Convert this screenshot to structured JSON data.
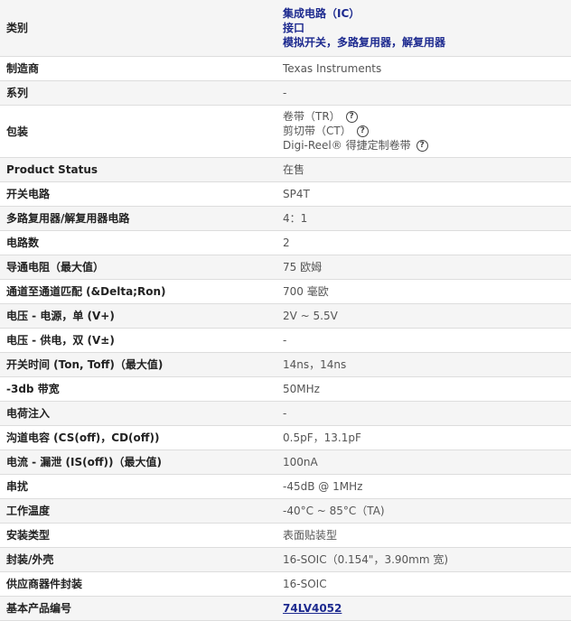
{
  "rows": {
    "category": {
      "label": "类别",
      "values": [
        "集成电路（IC）",
        "接口",
        "模拟开关，多路复用器，解复用器"
      ]
    },
    "manufacturer": {
      "label": "制造商",
      "value": "Texas Instruments"
    },
    "series": {
      "label": "系列",
      "value": "-"
    },
    "packaging": {
      "label": "包装",
      "values": [
        "卷带（TR）",
        "剪切带（CT）",
        "Digi-Reel® 得捷定制卷带"
      ]
    },
    "product_status": {
      "label": "Product Status",
      "value": "在售"
    },
    "switch_circuit": {
      "label": "开关电路",
      "value": "SP4T"
    },
    "mux_circuit": {
      "label": "多路复用器/解复用器电路",
      "value": "4：1"
    },
    "circuit_count": {
      "label": "电路数",
      "value": "2"
    },
    "on_resistance": {
      "label": "导通电阻（最大值）",
      "value": "75 欧姆"
    },
    "channel_match": {
      "label": "通道至通道匹配 (&Delta;Ron)",
      "value": "700 毫欧"
    },
    "voltage_single": {
      "label": "电压 - 电源，单 (V+)",
      "value": "2V ~ 5.5V"
    },
    "voltage_dual": {
      "label": "电压 - 供电，双 (V±)",
      "value": "-"
    },
    "switch_time": {
      "label": "开关时间 (Ton, Toff)（最大值)",
      "value": "14ns，14ns"
    },
    "bandwidth": {
      "label": "-3db 带宽",
      "value": "50MHz"
    },
    "charge_injection": {
      "label": "电荷注入",
      "value": "-"
    },
    "channel_cap": {
      "label": "沟道电容 (CS(off)，CD(off))",
      "value": "0.5pF，13.1pF"
    },
    "leakage": {
      "label": "电流 - 漏泄 (IS(off))（最大值)",
      "value": "100nA"
    },
    "crosstalk": {
      "label": "串扰",
      "value": "-45dB @ 1MHz"
    },
    "temperature": {
      "label": "工作温度",
      "value": "-40°C ~ 85°C（TA)"
    },
    "mount_type": {
      "label": "安装类型",
      "value": "表面贴装型"
    },
    "package_case": {
      "label": "封装/外壳",
      "value": "16-SOIC（0.154\"，3.90mm 宽)"
    },
    "supplier_package": {
      "label": "供应商器件封装",
      "value": "16-SOIC"
    },
    "base_part": {
      "label": "基本产品编号",
      "value": "74LV4052"
    }
  },
  "icons": {
    "help": "help-circle-icon",
    "help_glyph": "?"
  },
  "colors": {
    "link": "#1d2a8f",
    "row_alt": "#f5f5f5",
    "border": "#dddddd"
  }
}
